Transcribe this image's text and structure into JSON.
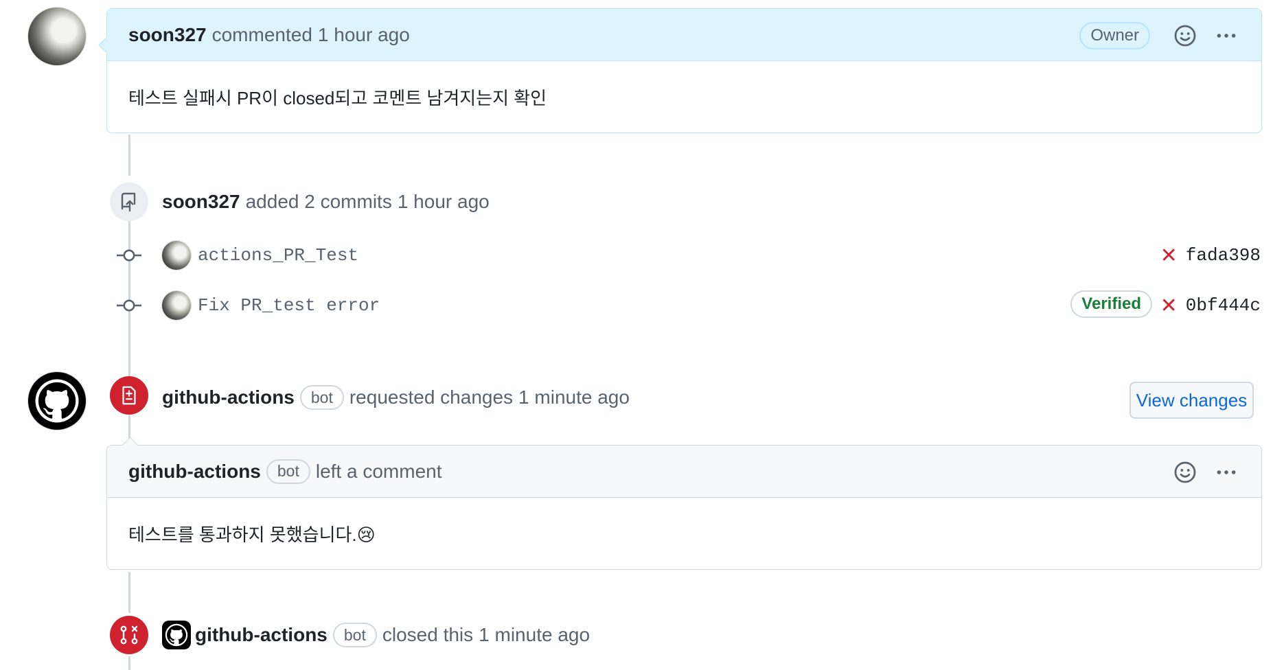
{
  "comment1": {
    "author": "soon327",
    "action": "commented",
    "time": "1 hour ago",
    "role_badge": "Owner",
    "body": "테스트 실패시 PR이 closed되고 코멘트 남겨지는지 확인"
  },
  "commits_event": {
    "author": "soon327",
    "action": "added 2 commits",
    "time": "1 hour ago",
    "commits": [
      {
        "message": "actions_PR_Test",
        "sha": "fada398",
        "verified": ""
      },
      {
        "message": "Fix PR_test error",
        "sha": "0bf444c",
        "verified": "Verified"
      }
    ]
  },
  "review_event": {
    "author": "github-actions",
    "bot_label": "bot",
    "action": "requested changes",
    "time": "1 minute ago",
    "button": "View changes"
  },
  "review_comment": {
    "author": "github-actions",
    "bot_label": "bot",
    "action": "left a comment",
    "body": "테스트를 통과하지 못했습니다.😢"
  },
  "close_event": {
    "author": "github-actions",
    "bot_label": "bot",
    "action": "closed this",
    "time": "1 minute ago"
  },
  "colors": {
    "owner_header": "#ddf4ff",
    "danger": "#cf222e",
    "success": "#1a7f37",
    "link": "#0969da"
  },
  "icons": [
    "smiley-icon",
    "kebab-horizontal-icon",
    "repo-push-icon",
    "git-commit-icon",
    "file-diff-icon",
    "git-pull-request-closed-icon",
    "x-icon",
    "github-mark-icon"
  ]
}
